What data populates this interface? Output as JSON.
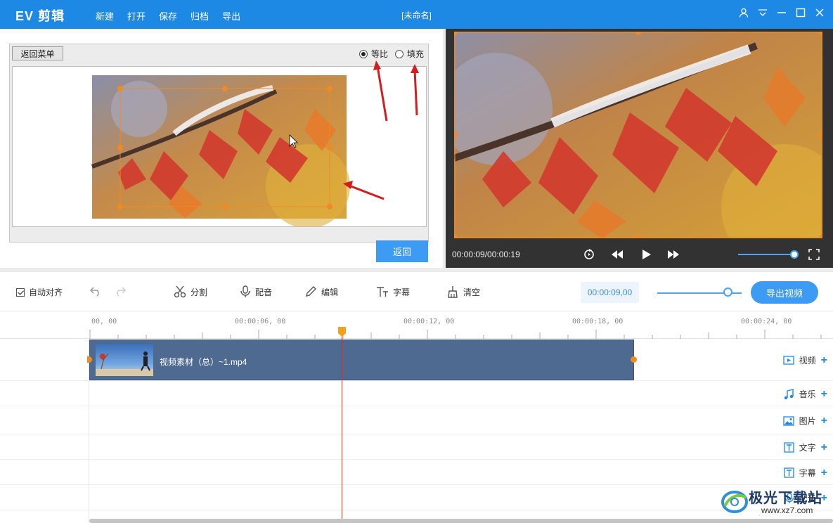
{
  "app": {
    "logo": "EV 剪辑",
    "menu": [
      "新建",
      "打开",
      "保存",
      "归档",
      "导出"
    ],
    "doc_title": "[未命名]",
    "window_icons": [
      "user-icon",
      "menu-collapse-icon",
      "minimize-icon",
      "maximize-icon",
      "close-icon"
    ]
  },
  "crop_editor": {
    "back_menu_label": "返回菜单",
    "mode_options": [
      {
        "label": "等比",
        "selected": true
      },
      {
        "label": "填充",
        "selected": false
      }
    ],
    "back_label": "返回"
  },
  "preview": {
    "time": "00:00:09/00:00:19",
    "controls": [
      "replay-icon",
      "rewind-icon",
      "play-icon",
      "fast-forward-icon",
      "fullscreen-icon"
    ],
    "volume_fraction": 0.92
  },
  "toolbar": {
    "auto_align_label": "自动对齐",
    "auto_align_checked": true,
    "undo_icon": "undo-icon",
    "redo_icon": "redo-icon",
    "split_label": "分割",
    "dub_label": "配音",
    "edit_label": "编辑",
    "subtitle_label": "字幕",
    "clear_label": "清空",
    "timecode": "00:00:09,00",
    "zoom_fraction": 0.85,
    "export_label": "导出视频"
  },
  "timeline": {
    "ruler_labels": [
      "00, 00",
      "00:00:06, 00",
      "00:00:12, 00",
      "00:00:18, 00",
      "00:00:24, 00"
    ],
    "tracks": [
      {
        "label": "视频",
        "icon": "video-track-icon"
      },
      {
        "label": "音乐",
        "icon": "music-note-icon"
      },
      {
        "label": "图片",
        "icon": "image-icon"
      },
      {
        "label": "文字",
        "icon": "text-icon"
      },
      {
        "label": "字幕",
        "icon": "subtitle-icon"
      },
      {
        "label": "配音",
        "icon": "microphone-icon"
      }
    ],
    "clip_name": "视频素材（总）~1.mp4"
  },
  "watermark": {
    "brand": "极光下载站",
    "url": "www.xz7.com"
  },
  "colors": {
    "accent": "#1e88e5",
    "button": "#3e9bf3",
    "clip": "#4f6a91",
    "playhead": "#d52b1e",
    "handle": "#f08a24"
  }
}
